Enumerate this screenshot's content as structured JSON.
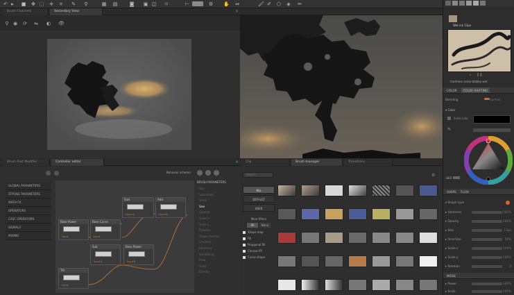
{
  "viewer_tabs": [
    "Brush Channels",
    "Secondary View"
  ],
  "bottom_left_tabs": [
    "Brush Post Modifier",
    "Controller editor"
  ],
  "bottom_right_tabs": [
    "Clip",
    "Brush manager",
    "Transitions"
  ],
  "controller": {
    "schema_label": "Behavior schema",
    "categories": [
      "GLOBAL PARAMETERS",
      "STROKE PARAMETERS",
      "MATH FX",
      "OPERATORS",
      "CAST OPERATORS",
      "SIGNALS",
      "MIXING"
    ],
    "params_title": "BRUSH PARAMETERS",
    "params": [
      "Size",
      "Saturation",
      "Value",
      "Size",
      "Opacity",
      "Scale x",
      "Scale y",
      "Rotation",
      "Shape reverse",
      "Gradient",
      "Hardness",
      "Smoothing",
      "Flow",
      "Scale",
      "Density"
    ],
    "nodes": [
      {
        "title": "Base Power",
        "port": "Input"
      },
      {
        "title": "Base Curve",
        "port": "Input"
      },
      {
        "title": "Size",
        "port": "Input A"
      },
      {
        "title": "Add",
        "port": "Input B"
      },
      {
        "title": "Sub",
        "port": "Input A"
      },
      {
        "title": "Base Power",
        "port": "Input B"
      },
      {
        "title": "Tilt",
        "port": "Input"
      }
    ]
  },
  "brush_manager": {
    "search_placeholder": "Search",
    "filters": [
      "ALL",
      "DEFAULT",
      "USER"
    ],
    "more_filters_label": "More filters",
    "toggle": [
      "All",
      "None"
    ],
    "checks": [
      "Shape map",
      "Fill",
      "Polygonal fill",
      "Canvas fill",
      "Curve shape"
    ]
  },
  "right_panel": {
    "brush_name": "Wet ink 13px",
    "preset_caption": "hardness noise blobby wet",
    "color_tabs": [
      "COLOR",
      "COLOR SHIFTING"
    ],
    "blending_label": "Blending",
    "blending_value": "normal",
    "color_section": "Color",
    "solid_color_label": "Solid color",
    "hex_label": "HEX",
    "shape_tabs": [
      "SHAPE",
      "FLOW"
    ],
    "shape_type_label": "Shape type",
    "shape_params": [
      {
        "label": "Hardness",
        "val": "100%"
      },
      {
        "label": "Opacity",
        "val": "100%"
      },
      {
        "label": "Size",
        "val": "13px"
      },
      {
        "label": "InnerSize",
        "val": "50%"
      },
      {
        "label": "Scale x",
        "val": "100%"
      },
      {
        "label": "Scale y",
        "val": "100%"
      },
      {
        "label": "Rotation",
        "val": "0"
      }
    ],
    "noise_header": "NOISE",
    "noise_params": [
      {
        "label": "Power",
        "val": "100%"
      },
      {
        "label": "Scale",
        "val": "100%"
      }
    ]
  },
  "colors": {
    "accent": "#d9662a",
    "node_port": "#d07a30",
    "swatch": "#000000"
  }
}
